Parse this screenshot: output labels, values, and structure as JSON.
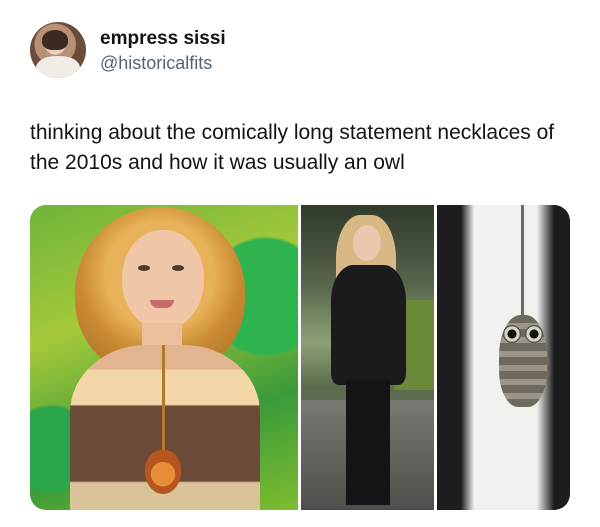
{
  "author": {
    "display_name": "empress sissi",
    "handle": "@historicalfits"
  },
  "tweet": {
    "text": "thinking about the comically long statement necklaces of the 2010s and how it was usually an owl"
  }
}
